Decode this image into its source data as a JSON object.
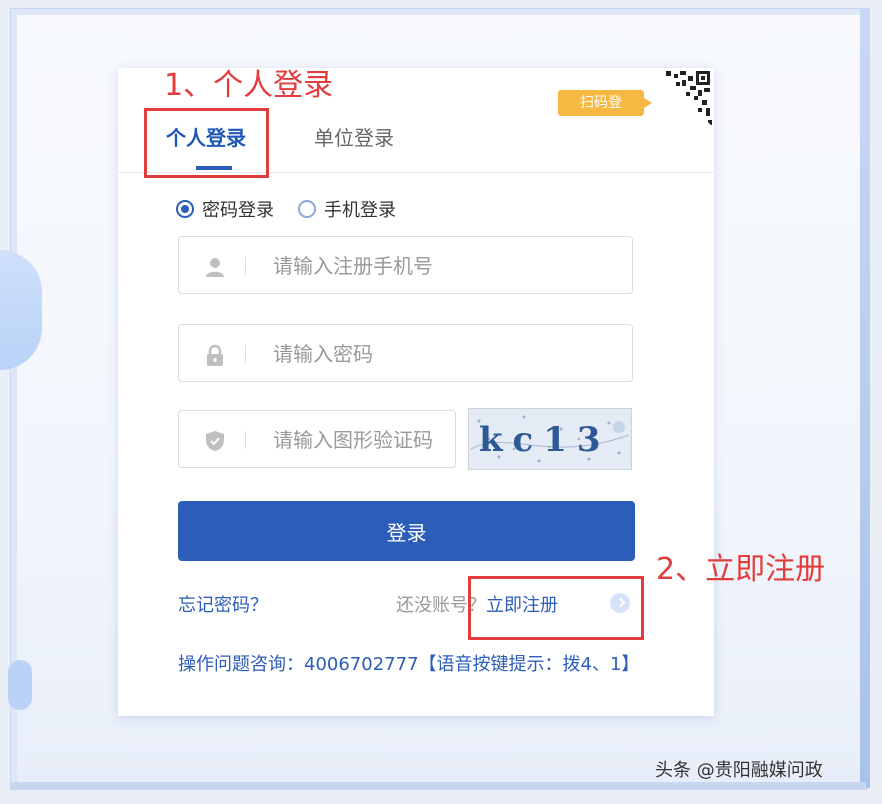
{
  "annotations": {
    "step1": "1、个人登录",
    "step2": "2、立即注册"
  },
  "tabs": {
    "personal": "个人登录",
    "company": "单位登录"
  },
  "scan_badge": "扫码登",
  "login_mode": {
    "password": "密码登录",
    "phone": "手机登录",
    "selected": "password"
  },
  "fields": {
    "phone_placeholder": "请输入注册手机号",
    "password_placeholder": "请输入密码",
    "captcha_placeholder": "请输入图形验证码",
    "captcha_text": "kc13"
  },
  "login_button": "登录",
  "forgot_password": "忘记密码？",
  "no_account": "还没账号？",
  "register": "立即注册",
  "help_text": "操作问题咨询：4006702777【语音按键提示：拨4、1】",
  "watermark": "头条 @贵阳融媒问政",
  "colors": {
    "primary": "#2b5db9",
    "annotation": "#e23c3c",
    "badge": "#f7b843"
  },
  "icons": {
    "user": "user-icon",
    "lock": "lock-icon",
    "shield": "shield-icon",
    "arrow": "chevron-right-icon",
    "qr": "qr-code-icon"
  }
}
